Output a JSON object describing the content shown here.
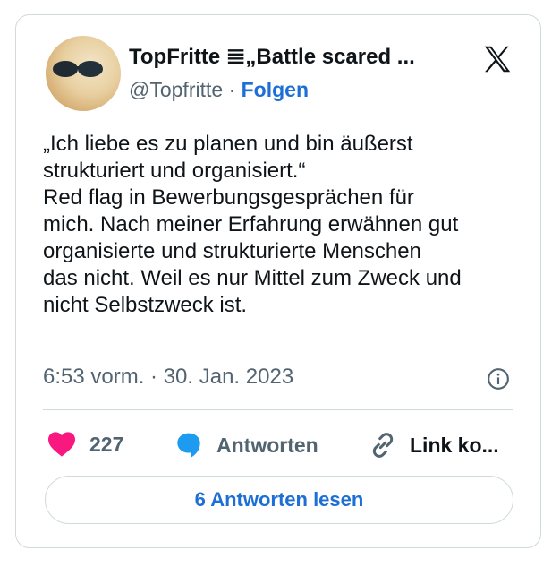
{
  "author": {
    "name": "TopFritte 𝌆„Battle scared ...",
    "handle": "@Topfritte",
    "separator": "·",
    "follow_label": "Folgen"
  },
  "tweet": {
    "text": "„Ich liebe es zu planen und bin äußerst\nstrukturiert und organisiert.“\nRed flag in Bewerbungsgesprächen für\nmich. Nach meiner Erfahrung erwähnen gut\norganisierte und strukturierte Menschen\ndas nicht. Weil es nur Mittel zum Zweck und\nnicht Selbstzweck ist.",
    "timestamp": "6:53 vorm. · 30. Jan. 2023"
  },
  "actions": {
    "likes_count": "227",
    "reply_label": "Antworten",
    "link_label": "Link ko..."
  },
  "read_replies_label": "6 Antworten lesen",
  "icons": {
    "logo": "x-logo-icon",
    "info": "info-icon",
    "like": "heart-icon",
    "reply": "speech-bubble-icon",
    "link": "link-icon"
  },
  "colors": {
    "accent": "#1d6fd6",
    "heart": "#f91880",
    "muted": "#536471",
    "border": "#cfd9de"
  }
}
